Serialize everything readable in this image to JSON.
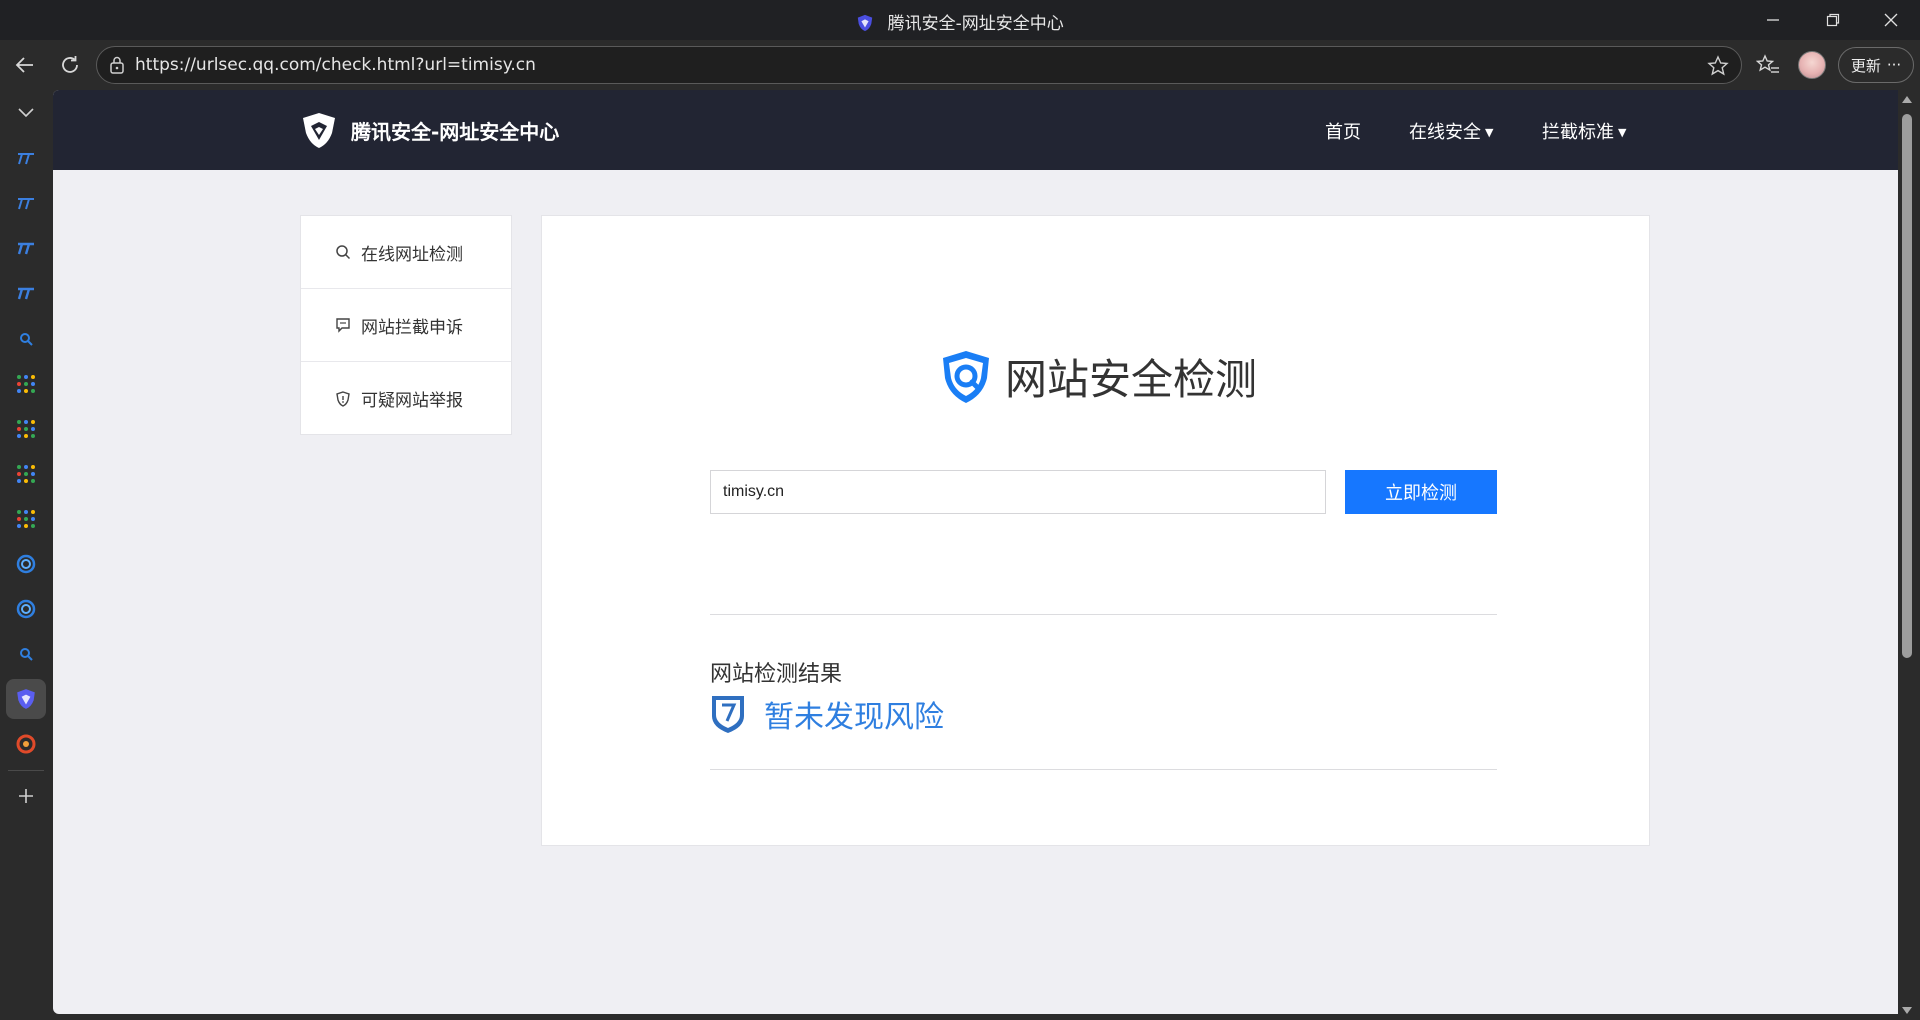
{
  "browser": {
    "window_title": "腾讯安全-网址安全中心",
    "url": "https://urlsec.qq.com/check.html?url=timisy.cn",
    "update_label": "更新",
    "more_label": "···"
  },
  "site": {
    "logo_text": "腾讯安全-网址安全中心",
    "nav": [
      {
        "label": "首页"
      },
      {
        "label": "在线安全"
      },
      {
        "label": "拦截标准"
      }
    ]
  },
  "sidebar": {
    "items": [
      {
        "label": "在线网址检测",
        "icon": "search-icon"
      },
      {
        "label": "网站拦截申诉",
        "icon": "message-icon"
      },
      {
        "label": "可疑网站举报",
        "icon": "shield-alert-icon"
      }
    ]
  },
  "main": {
    "title": "网站安全检测",
    "input_value": "timisy.cn",
    "button_label": "立即检测",
    "result_label": "网站检测结果",
    "result_status": "暂未发现风险"
  },
  "colors": {
    "accent": "#1677ff",
    "header_bg": "#222533",
    "result_text": "#2f7fe0"
  }
}
